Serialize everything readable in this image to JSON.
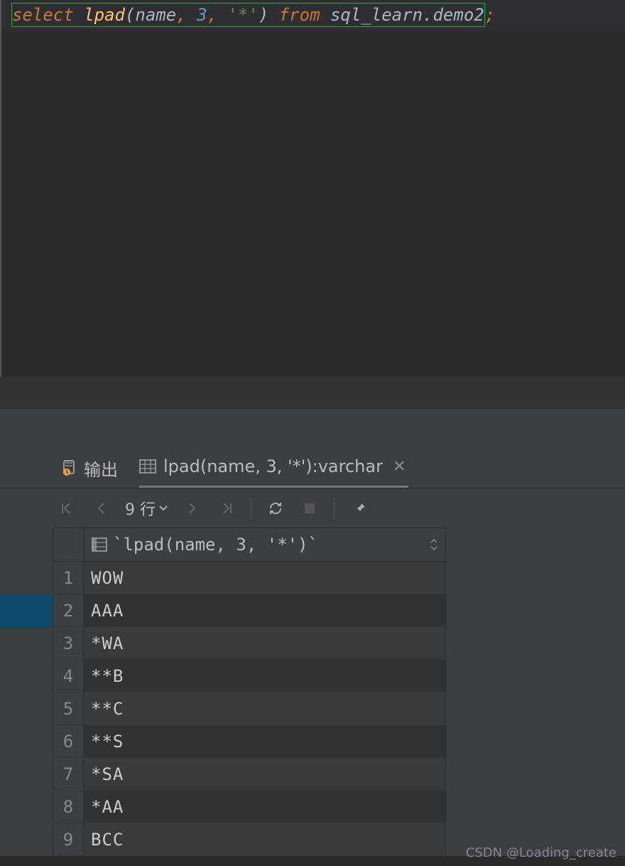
{
  "editor": {
    "tokens": {
      "select": "select ",
      "fn": "lpad",
      "lparen": "(",
      "arg1": "name",
      "comma1": ", ",
      "arg2": "3",
      "comma2": ", ",
      "arg3": "'*'",
      "rparen": ")",
      "from": " from ",
      "table": "sql_learn.demo2",
      "semi": ";"
    }
  },
  "tabs": {
    "output": "输出",
    "result_label": "lpad(name, 3, '*'):varchar"
  },
  "toolbar": {
    "row_count": "9 行"
  },
  "result": {
    "column_header": "`lpad(name, 3, '*')`",
    "rows": [
      {
        "n": "1",
        "v": "WOW"
      },
      {
        "n": "2",
        "v": "AAA"
      },
      {
        "n": "3",
        "v": "*WA"
      },
      {
        "n": "4",
        "v": "**B"
      },
      {
        "n": "5",
        "v": "**C"
      },
      {
        "n": "6",
        "v": "**S"
      },
      {
        "n": "7",
        "v": "*SA"
      },
      {
        "n": "8",
        "v": "*AA"
      },
      {
        "n": "9",
        "v": "BCC"
      }
    ]
  },
  "watermark": "CSDN @Loading_create"
}
